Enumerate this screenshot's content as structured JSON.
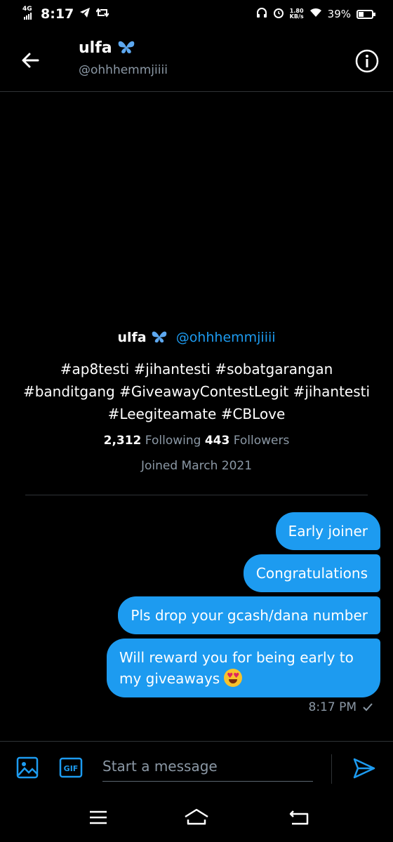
{
  "status_bar": {
    "network": "4G",
    "time": "8:17",
    "net_speed_value": "1.80",
    "net_speed_unit": "KB/s",
    "battery_text": "39%",
    "battery_level": 0.39
  },
  "header": {
    "name": "ulfa",
    "handle": "@ohhhemmjiiii"
  },
  "profile": {
    "name": "ulfa",
    "handle": "@ohhhemmjiiii",
    "bio": "#ap8testi #jihantesti #sobatgarangan #banditgang #GiveawayContestLegit #jihantesti #Leegiteamate #CBLove",
    "following_count": "2,312",
    "following_label": "Following",
    "followers_count": "443",
    "followers_label": "Followers",
    "joined": "Joined March 2021"
  },
  "messages": [
    {
      "text": "Early joiner"
    },
    {
      "text": "Congratulations"
    },
    {
      "text": "Pls drop your gcash/dana number"
    },
    {
      "text": "Will reward you for being early to my giveaways"
    }
  ],
  "timestamp": "8:17 PM",
  "composer": {
    "placeholder": "Start a message",
    "gif_label": "GIF"
  },
  "colors": {
    "background": "#000000",
    "accent": "#1d9bf0",
    "muted_text": "#8b98a5",
    "emoji_face": "#f7c22c"
  }
}
